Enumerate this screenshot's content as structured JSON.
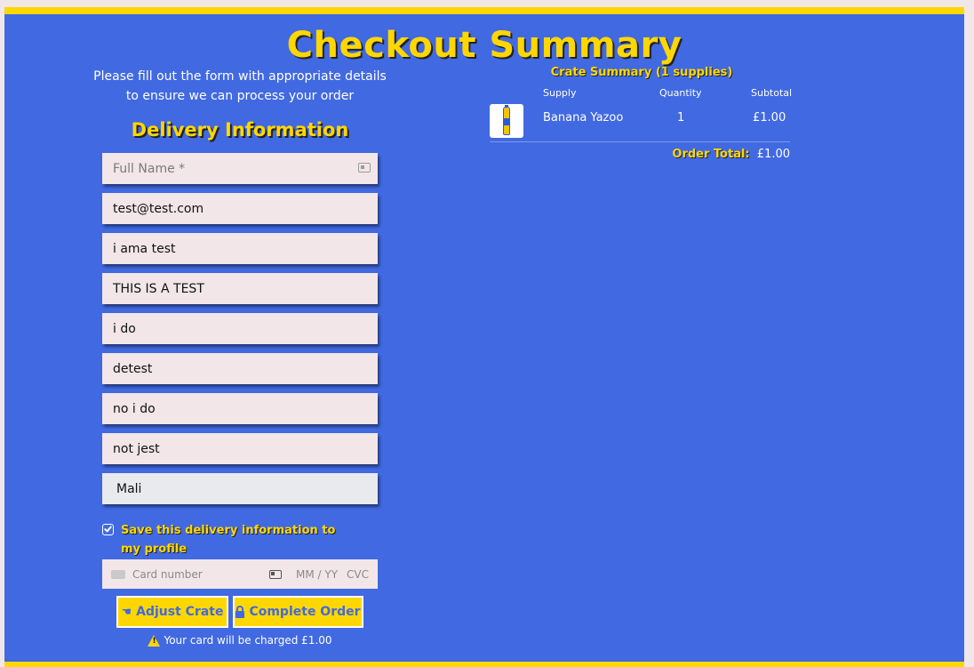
{
  "page": {
    "title": "Checkout Summary",
    "intro": "Please fill out the form with appropriate details to ensure we can process your order"
  },
  "delivery": {
    "title": "Delivery Information",
    "fields": [
      {
        "placeholder": "Full Name *",
        "value": ""
      },
      {
        "value": "test@test.com"
      },
      {
        "value": "i ama test"
      },
      {
        "value": "THIS IS A TEST"
      },
      {
        "value": "i do"
      },
      {
        "value": "detest"
      },
      {
        "value": "no i do"
      },
      {
        "value": "not jest"
      },
      {
        "value": "Mali"
      }
    ],
    "save_label": "Save this delivery information to my profile",
    "save_checked": true
  },
  "card": {
    "number_placeholder": "Card number",
    "expiry_placeholder": "MM / YY",
    "cvc_placeholder": "CVC"
  },
  "buttons": {
    "adjust_label": "Adjust Crate",
    "complete_label": "Complete Order"
  },
  "charge_note": "Your card will be charged £1.00",
  "summary": {
    "title": "Crate Summary (1 supplies)",
    "headers": {
      "supply": "Supply",
      "quantity": "Quantity",
      "subtotal": "Subtotal"
    },
    "items": [
      {
        "name": "Banana Yazoo",
        "quantity": "1",
        "subtotal": "£1.00"
      }
    ],
    "total_label": "Order Total:",
    "total_value": "£1.00"
  },
  "colors": {
    "panel": "#4169e1",
    "accent": "#ffd700",
    "background": "#f1e7e8"
  },
  "icons": [
    "contact-card-icon",
    "card-brand-icon",
    "hand-point-left-icon",
    "lock-icon",
    "warning-icon",
    "check-icon"
  ]
}
